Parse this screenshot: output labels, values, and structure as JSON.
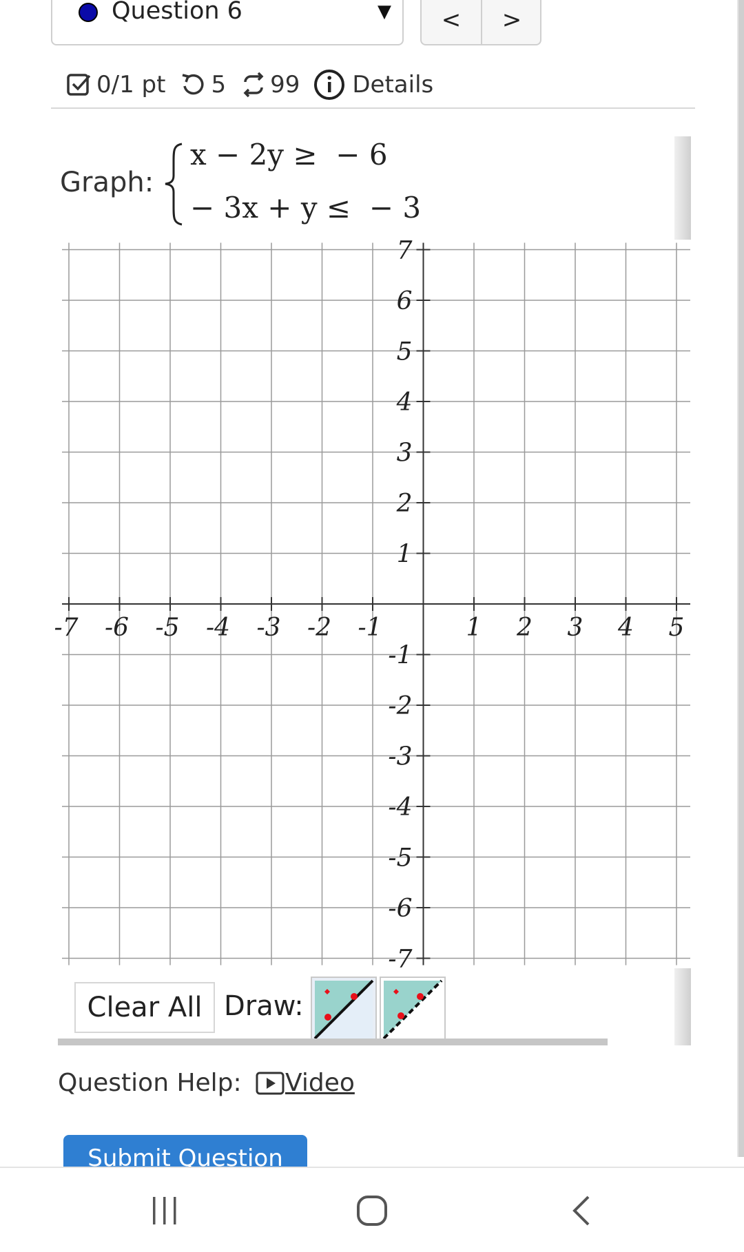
{
  "question": {
    "label": "Question 6",
    "prev": "<",
    "next": ">"
  },
  "info": {
    "points": "0/1 pt",
    "retries": "5",
    "attempts": "99",
    "details": "Details"
  },
  "graph": {
    "label": "Graph:",
    "eq1": "x − 2y ≥  − 6",
    "eq2": "− 3x + y ≤  − 3"
  },
  "chart_data": {
    "type": "scatter",
    "xlim": [
      -7,
      5
    ],
    "ylim": [
      -7,
      7
    ],
    "grid": true,
    "x_ticks": [
      -7,
      -6,
      -5,
      -4,
      -3,
      -2,
      -1,
      1,
      2,
      3,
      4,
      5
    ],
    "y_ticks": [
      7,
      6,
      5,
      4,
      3,
      2,
      1,
      -1,
      -2,
      -3,
      -4,
      -5,
      -6,
      -7
    ]
  },
  "controls": {
    "clear_all": "Clear All",
    "draw_label": "Draw:"
  },
  "help": {
    "label": "Question Help:",
    "video": "Video"
  },
  "submit": "Submit Question",
  "colors": {
    "accent": "#2f7fd2",
    "question_dot": "#0a0aa8",
    "tool_bg": "#99d3cc",
    "tool_point": "#e8101a"
  }
}
